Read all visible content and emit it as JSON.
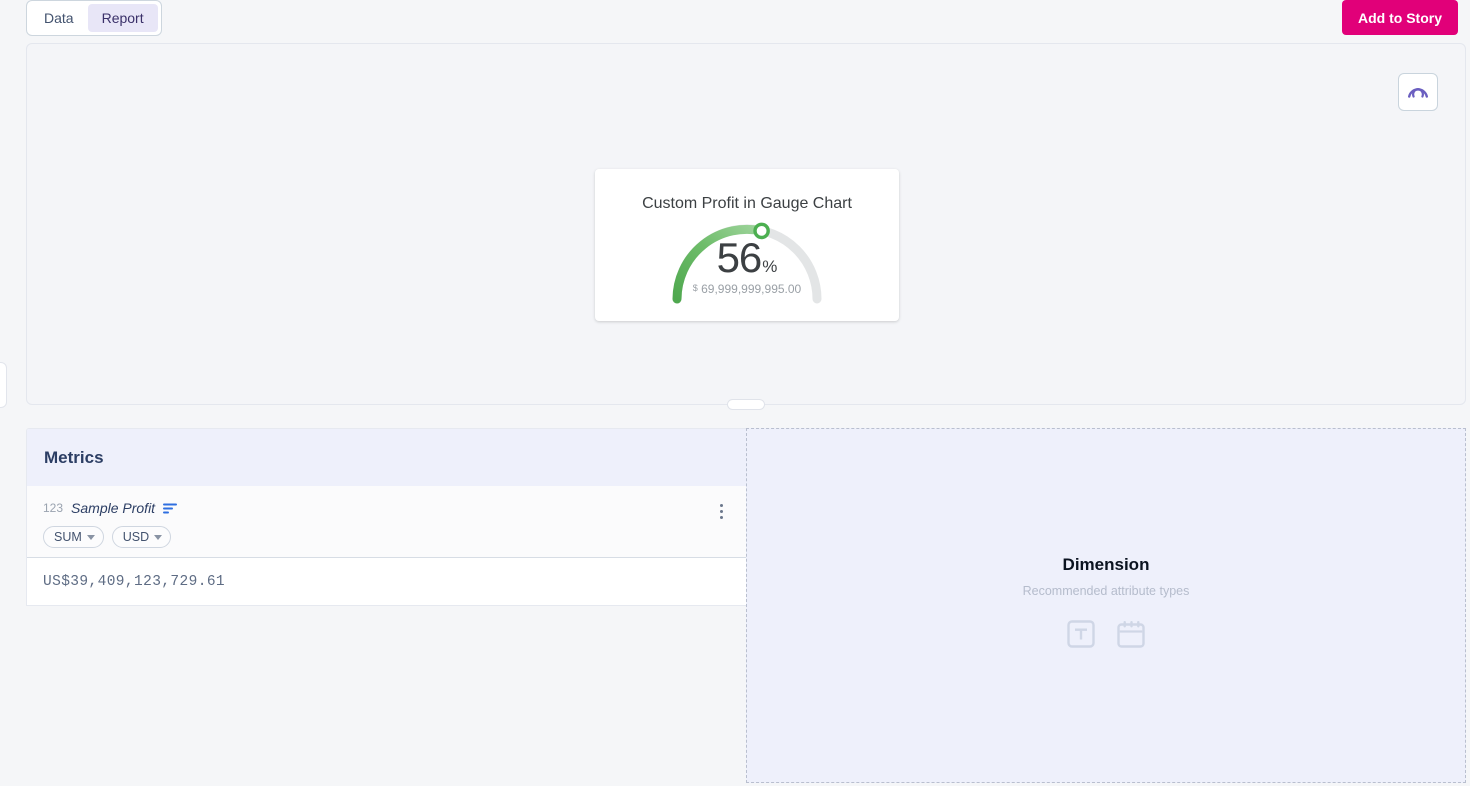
{
  "topbar": {
    "tabs": [
      {
        "label": "Data",
        "active": false
      },
      {
        "label": "Report",
        "active": true
      }
    ],
    "add_to_story_label": "Add to Story",
    "accent_pink": "#e10079",
    "active_tab_bg": "#e8e6f7"
  },
  "canvas": {
    "chart_type_icon": "gauge-icon",
    "chart_type_icon_color": "#6b5fc0",
    "resize_handle": "horizontal-resize-handle"
  },
  "gauge_card": {
    "title": "Custom Profit in Gauge Chart",
    "value": "56",
    "unit": "%",
    "subtitle_currency": "$",
    "subtitle_amount": "69,999,999,995.00",
    "arc_color_start": "#5cb85c",
    "arc_color_end": "#8ed08a",
    "track_color": "#e3e5e6",
    "marker_color": "#4caf50"
  },
  "chart_data": {
    "type": "gauge",
    "title": "Custom Profit in Gauge Chart",
    "value": 56,
    "unit": "%",
    "min": 0,
    "max": 100,
    "display_total": "69,999,999,995.00",
    "currency_symbol": "$",
    "series": [
      {
        "name": "Custom Profit",
        "value": 56
      }
    ],
    "arc_start_angle": 180,
    "arc_end_angle": 0,
    "filled_fraction": 0.56,
    "colors": {
      "fill_start": "#5cb85c",
      "fill_end": "#9ed49b",
      "track": "#e3e5e6"
    }
  },
  "shelf": {
    "metrics": {
      "panel_title": "Metrics",
      "rows": [
        {
          "type_badge": "123",
          "name": "Sample Profit",
          "sort_icon": "sort-descending-icon",
          "aggregation": "SUM",
          "currency": "USD",
          "menu_icon": "kebab-menu-icon",
          "value": "US$39,409,123,729.61"
        }
      ]
    },
    "dimension": {
      "title": "Dimension",
      "subtitle": "Recommended attribute types",
      "icons": [
        {
          "name": "text-attribute-icon",
          "glyph": "T"
        },
        {
          "name": "date-attribute-icon",
          "glyph": "calendar"
        }
      ]
    }
  },
  "left_edge": {
    "handle": "collapse-panel-handle"
  }
}
